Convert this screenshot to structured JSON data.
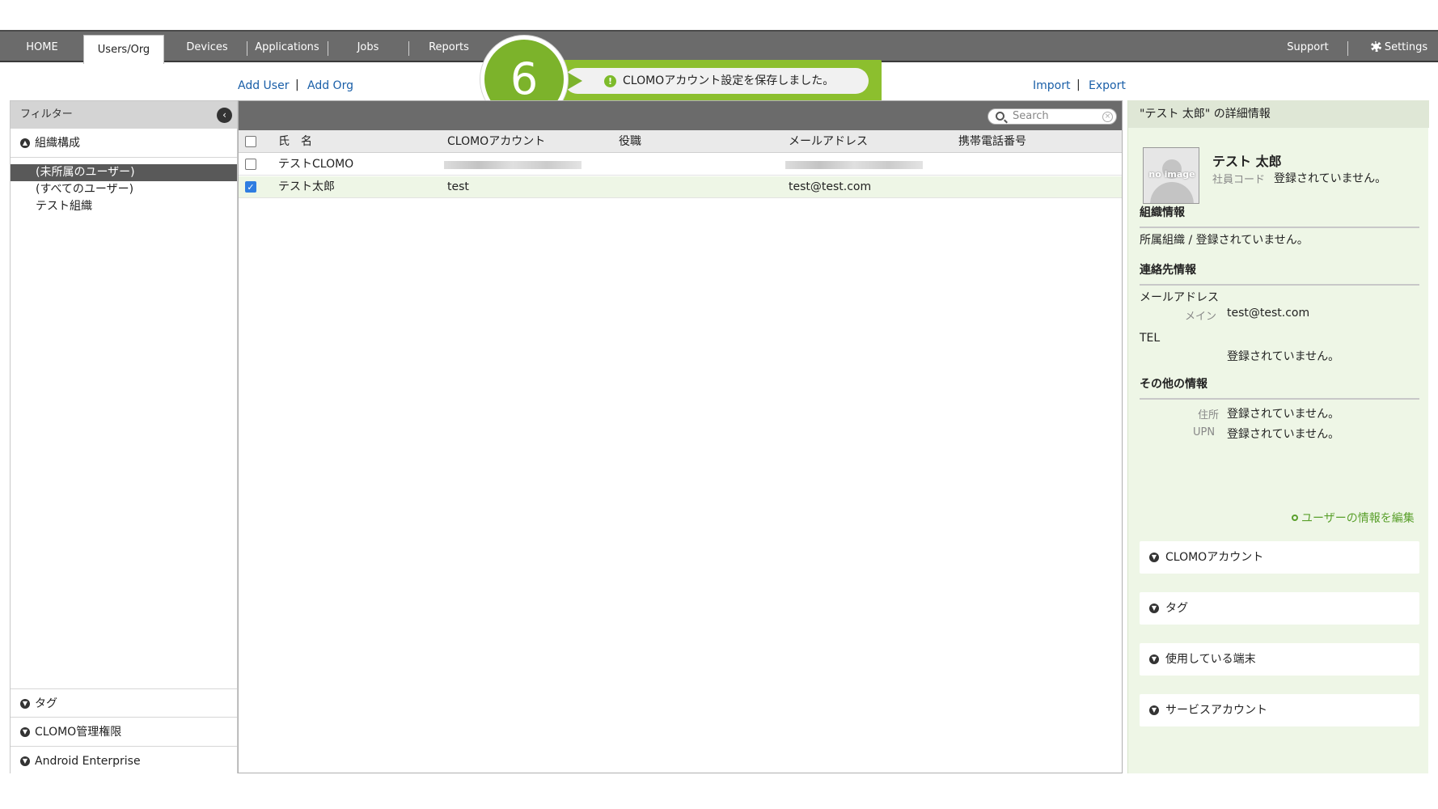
{
  "nav": {
    "items": [
      "HOME",
      "Users/Org",
      "Devices",
      "Applications",
      "Jobs",
      "Reports"
    ],
    "right_items": [
      "Support",
      "Settings"
    ],
    "active": "Users/Org"
  },
  "actions": {
    "add_user": "Add User",
    "add_org": "Add Org",
    "import": "Import",
    "export": "Export",
    "sep": "|"
  },
  "toast": {
    "step_number": "6",
    "message": "CLOMOアカウント設定を保存しました。",
    "icon": "!"
  },
  "filter": {
    "title": "フィルター",
    "org_section": "組織構成",
    "org_items": [
      "(未所属のユーザー)",
      "(すべてのユーザー)",
      "テスト組織"
    ],
    "selected_index": 0,
    "bottom_sections": [
      "タグ",
      "CLOMO管理権限",
      "Android Enterprise"
    ]
  },
  "search": {
    "placeholder": "Search"
  },
  "table": {
    "columns": [
      "氏　名",
      "CLOMOアカウント",
      "役職",
      "メールアドレス",
      "携帯電話番号"
    ],
    "rows": [
      {
        "name": "テストCLOMO",
        "account": "",
        "title": "",
        "email": "",
        "phone": "",
        "checked": false
      },
      {
        "name": "テスト太郎",
        "account": "test",
        "title": "",
        "email": "test@test.com",
        "phone": "",
        "checked": true
      }
    ]
  },
  "detail": {
    "header": "\"テスト 太郎\" の詳細情報",
    "avatar_text": "no image",
    "name": "テスト 太郎",
    "employee_code_label": "社員コード",
    "employee_code_value": "登録されていません。",
    "org_section": "組織情報",
    "org_line": "所属組織 / 登録されていません。",
    "contact_section": "連絡先情報",
    "email_label": "メールアドレス",
    "email_main_label": "メイン",
    "email_main_value": "test@test.com",
    "tel_label": "TEL",
    "tel_value": "登録されていません。",
    "other_section": "その他の情報",
    "address_label": "住所",
    "address_value": "登録されていません。",
    "upn_label": "UPN",
    "upn_value": "登録されていません。",
    "edit_link": "ユーザーの情報を編集",
    "accordions": [
      "CLOMOアカウント",
      "タグ",
      "使用している端末",
      "サービスアカウント"
    ]
  },
  "colors": {
    "nav_bg": "#6b6b6b",
    "accent_green": "#7cb32b",
    "link_blue": "#1a5fa8",
    "detail_bg": "#eef6e6",
    "selected_row": "#595959"
  }
}
